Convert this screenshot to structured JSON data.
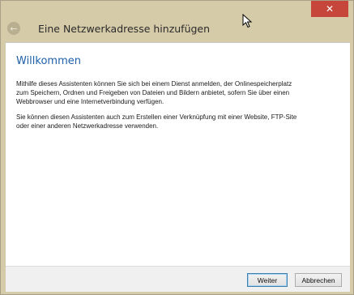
{
  "window": {
    "title": "Eine Netzwerkadresse hinzufügen",
    "close_glyph": "✕"
  },
  "content": {
    "heading": "Willkommen",
    "paragraph1": "Mithilfe dieses Assistenten können Sie sich bei einem Dienst anmelden, der Onlinespeicherplatz\nzum Speichern, Ordnen und Freigeben von Dateien und Bildern anbietet, sofern Sie über einen\nWebbrowser und eine Internetverbindung verfügen.",
    "paragraph2": "Sie können diesen Assistenten auch zum Erstellen einer Verknüpfung mit einer Website, FTP-Site\noder einer anderen Netzwerkadresse verwenden."
  },
  "footer": {
    "next_label": "Weiter",
    "cancel_label": "Abbrechen"
  },
  "icons": {
    "back": "back-arrow-icon",
    "close": "close-icon",
    "cursor": "mouse-cursor-icon"
  },
  "colors": {
    "window_frame": "#d6cba9",
    "close_button": "#c7463b",
    "heading": "#1d5fa8"
  }
}
